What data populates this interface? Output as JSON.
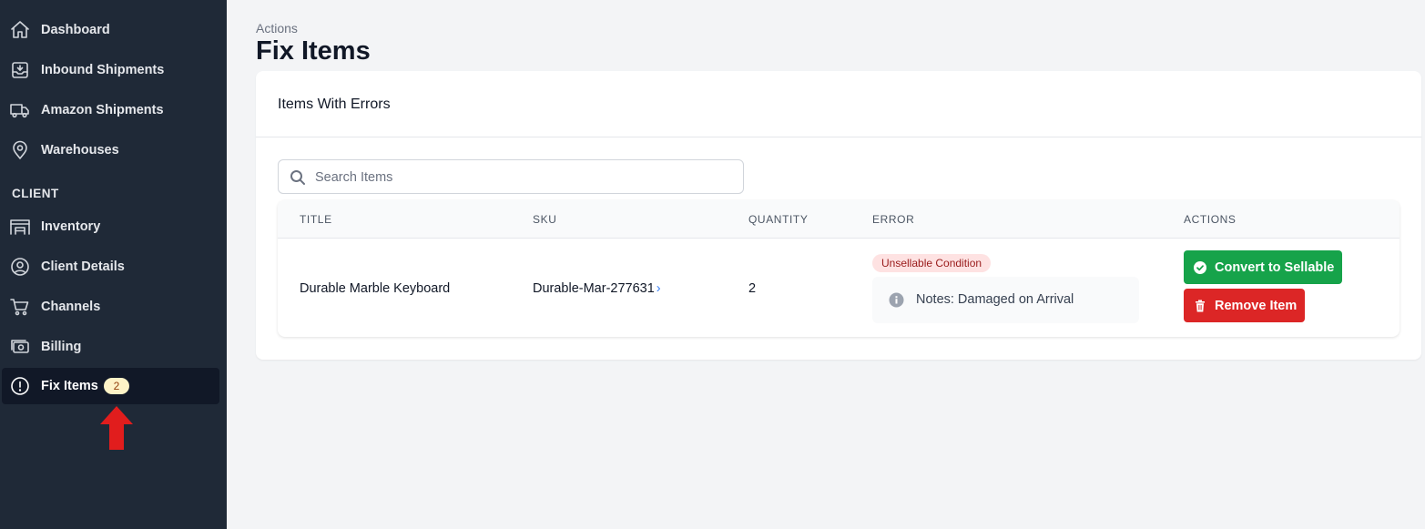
{
  "sidebar": {
    "items": [
      {
        "label": "Dashboard",
        "icon": "home-icon"
      },
      {
        "label": "Inbound Shipments",
        "icon": "inbox-download-icon"
      },
      {
        "label": "Amazon Shipments",
        "icon": "truck-icon"
      },
      {
        "label": "Warehouses",
        "icon": "map-pin-icon"
      }
    ],
    "section_label": "CLIENT",
    "client_items": [
      {
        "label": "Inventory",
        "icon": "warehouse-icon"
      },
      {
        "label": "Client Details",
        "icon": "user-circle-icon"
      },
      {
        "label": "Channels",
        "icon": "cart-icon"
      },
      {
        "label": "Billing",
        "icon": "cash-icon"
      },
      {
        "label": "Fix Items",
        "icon": "exclamation-circle-icon",
        "badge": "2",
        "active": true
      }
    ]
  },
  "header": {
    "breadcrumb": "Actions",
    "title": "Fix Items"
  },
  "card": {
    "title": "Items With Errors",
    "search_placeholder": "Search Items"
  },
  "table": {
    "columns": [
      "TITLE",
      "SKU",
      "QUANTITY",
      "ERROR",
      "ACTIONS"
    ],
    "rows": [
      {
        "title": "Durable Marble Keyboard",
        "sku": "Durable-Mar-277631",
        "sku_chevron": "›",
        "quantity": "2",
        "error": "Unsellable Condition",
        "note": "Notes: Damaged on Arrival",
        "actions": {
          "convert": "Convert to Sellable",
          "remove": "Remove Item"
        }
      }
    ]
  },
  "colors": {
    "sidebar_bg": "#1f2937",
    "active_bg": "#111827",
    "success": "#16a34a",
    "danger": "#dc2626",
    "annotation_arrow": "#e11d1d"
  }
}
